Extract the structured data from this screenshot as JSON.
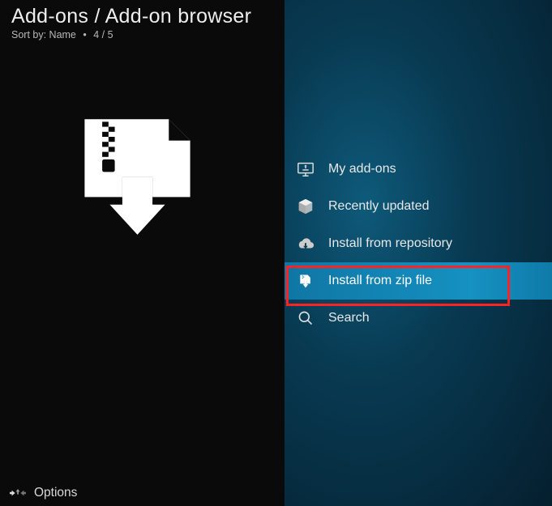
{
  "header": {
    "title": "Add-ons / Add-on browser",
    "sort_label": "Sort by: Name",
    "position": "4 / 5"
  },
  "menu": {
    "items": [
      {
        "label": "My add-ons"
      },
      {
        "label": "Recently updated"
      },
      {
        "label": "Install from repository"
      },
      {
        "label": "Install from zip file"
      },
      {
        "label": "Search"
      }
    ]
  },
  "footer": {
    "options_label": "Options"
  }
}
